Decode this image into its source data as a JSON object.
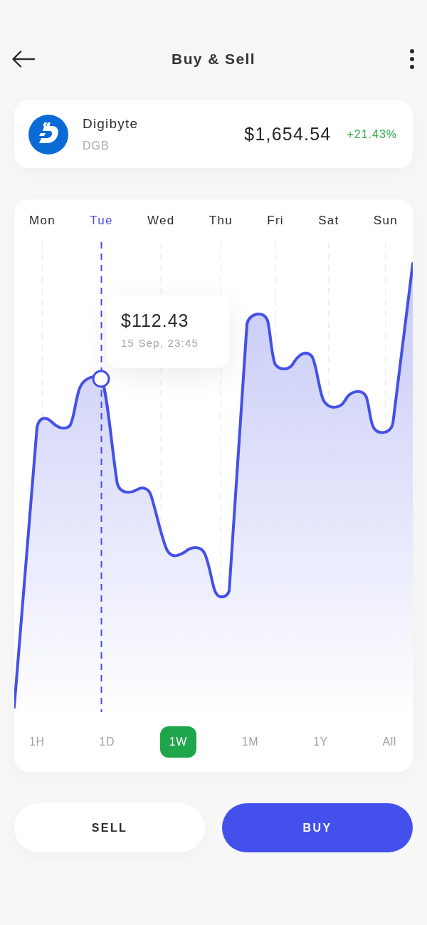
{
  "header": {
    "title": "Buy & Sell"
  },
  "coin": {
    "name": "Digibyte",
    "symbol": "DGB",
    "price": "$1,654.54",
    "change": "+21.43%"
  },
  "chart": {
    "days": [
      {
        "label": "Mon",
        "selected": false
      },
      {
        "label": "Tue",
        "selected": true
      },
      {
        "label": "Wed",
        "selected": false
      },
      {
        "label": "Thu",
        "selected": false
      },
      {
        "label": "Fri",
        "selected": false
      },
      {
        "label": "Sat",
        "selected": false
      },
      {
        "label": "Sun",
        "selected": false
      }
    ],
    "tooltip": {
      "value": "$112.43",
      "time": "15 Sep, 23:45"
    }
  },
  "ranges": [
    {
      "label": "1H",
      "selected": false
    },
    {
      "label": "1D",
      "selected": false
    },
    {
      "label": "1W",
      "selected": true
    },
    {
      "label": "1M",
      "selected": false
    },
    {
      "label": "1Y",
      "selected": false
    },
    {
      "label": "All",
      "selected": false
    }
  ],
  "actions": [
    {
      "label": "SELL",
      "kind": "secondary"
    },
    {
      "label": "BUY",
      "kind": "primary"
    }
  ]
}
